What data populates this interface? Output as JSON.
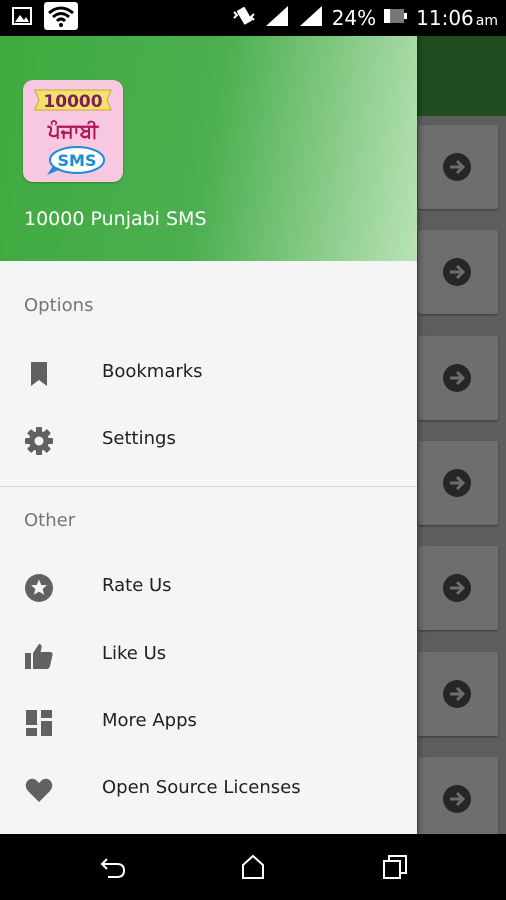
{
  "status_bar": {
    "battery": "24%",
    "time": "11:06",
    "time_suffix": "am",
    "icons": [
      "image-icon",
      "wifi-icon",
      "vibrate-icon",
      "signal-icon",
      "signal-icon",
      "battery-icon"
    ]
  },
  "drawer": {
    "logo": {
      "line1": "10000",
      "line2": "ਪੰਜਾਬੀ",
      "line3": "SMS"
    },
    "app_name": "10000 Punjabi SMS",
    "sections": [
      {
        "title": "Options",
        "items": [
          {
            "label": "Bookmarks",
            "icon": "bookmark-icon"
          },
          {
            "label": "Settings",
            "icon": "gear-icon"
          }
        ]
      },
      {
        "title": "Other",
        "items": [
          {
            "label": "Rate Us",
            "icon": "star-circle-icon"
          },
          {
            "label": "Like Us",
            "icon": "thumbs-up-icon"
          },
          {
            "label": "More Apps",
            "icon": "dashboard-icon"
          },
          {
            "label": "Open Source Licenses",
            "icon": "heart-icon"
          }
        ]
      }
    ]
  },
  "colors": {
    "header_start": "#3faa3f",
    "header_end": "#b9e2b6",
    "toolbar_behind": "#1f4d1f",
    "icon": "#616161"
  }
}
